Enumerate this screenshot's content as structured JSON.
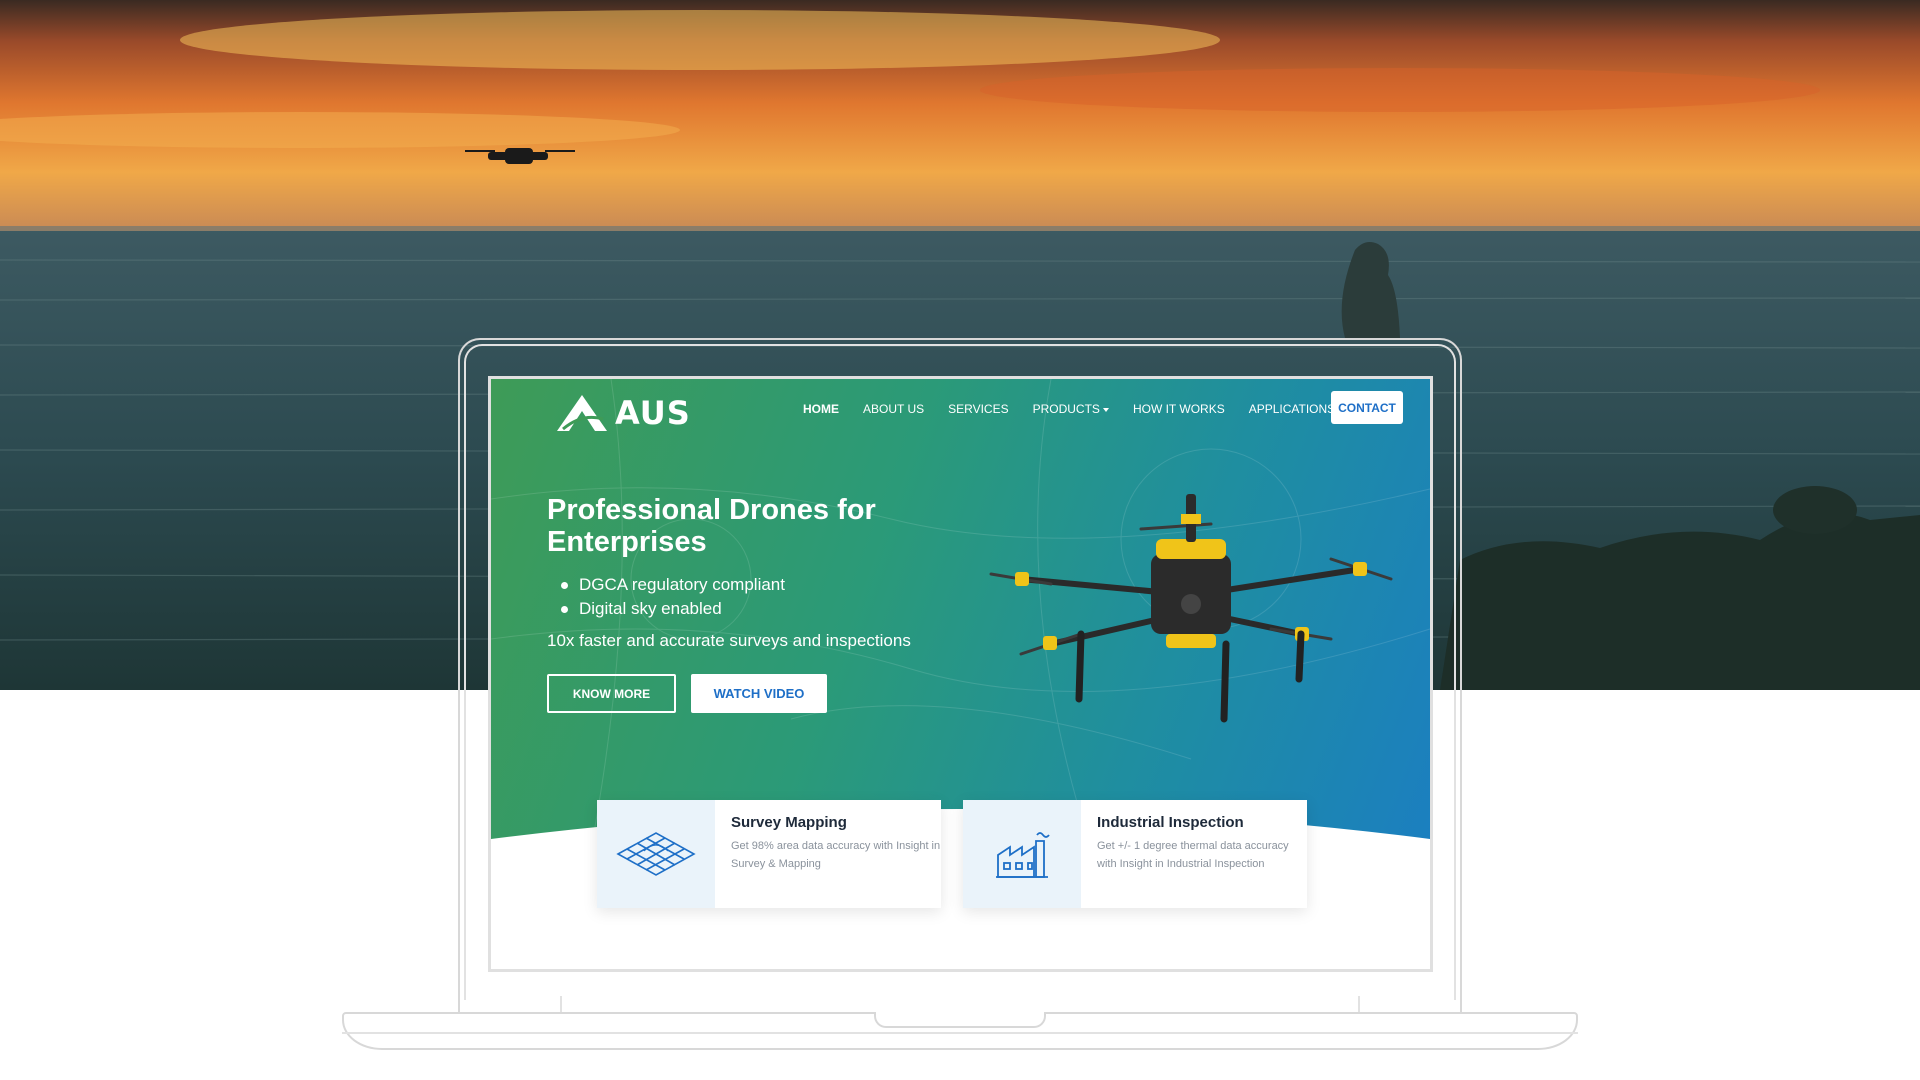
{
  "site": {
    "brand": "AUS",
    "nav": [
      {
        "label": "HOME",
        "active": true,
        "dropdown": false
      },
      {
        "label": "ABOUT US",
        "active": false,
        "dropdown": false
      },
      {
        "label": "SERVICES",
        "active": false,
        "dropdown": false
      },
      {
        "label": "PRODUCTS",
        "active": false,
        "dropdown": true
      },
      {
        "label": "HOW IT WORKS",
        "active": false,
        "dropdown": false
      },
      {
        "label": "APPLICATIONS",
        "active": false,
        "dropdown": true
      }
    ],
    "contact_label": "CONTACT"
  },
  "hero": {
    "title": "Professional Drones for Enterprises",
    "bullets": [
      "DGCA regulatory compliant",
      "Digital sky enabled"
    ],
    "subtitle": "10x faster and accurate surveys and inspections",
    "know_more_label": "KNOW MORE",
    "watch_video_label": "WATCH VIDEO"
  },
  "cards": [
    {
      "title": "Survey Mapping",
      "description": "Get 98% area data accuracy with Insight in Survey & Mapping",
      "icon": "terrain-grid-icon"
    },
    {
      "title": "Industrial Inspection",
      "description": "Get +/- 1 degree thermal data accuracy with Insight in Industrial Inspection",
      "icon": "factory-icon"
    }
  ],
  "colors": {
    "accent_blue": "#1e6fc7",
    "hero_green": "#3e9b57",
    "hero_blue": "#1b7fc0",
    "card_icon_bg": "#eaf3fa"
  }
}
